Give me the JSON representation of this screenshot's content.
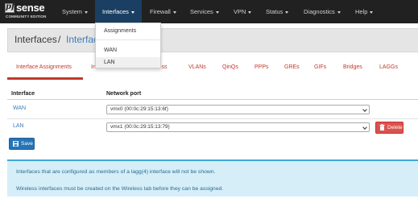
{
  "brand": {
    "pf": "pf",
    "sense": "sense",
    "edition": "COMMUNITY EDITION"
  },
  "navbar": {
    "items": [
      {
        "label": "System"
      },
      {
        "label": "Interfaces"
      },
      {
        "label": "Firewall"
      },
      {
        "label": "Services"
      },
      {
        "label": "VPN"
      },
      {
        "label": "Status"
      },
      {
        "label": "Diagnostics"
      },
      {
        "label": "Help"
      }
    ],
    "active": "Interfaces"
  },
  "dropdown": {
    "items": [
      {
        "label": "Assignments"
      },
      {
        "label": "WAN"
      },
      {
        "label": "LAN"
      }
    ],
    "highlighted": "LAN"
  },
  "breadcrumb": {
    "root": "Interfaces",
    "separator": "/",
    "current": "Interfac"
  },
  "tabs": [
    {
      "label": "Interface Assignments"
    },
    {
      "label": "In"
    },
    {
      "label": "less"
    },
    {
      "label": "VLANs"
    },
    {
      "label": "QinQs"
    },
    {
      "label": "PPPs"
    },
    {
      "label": "GREs"
    },
    {
      "label": "GIFs"
    },
    {
      "label": "Bridges"
    },
    {
      "label": "LAGGs"
    }
  ],
  "table": {
    "headers": {
      "interface": "Interface",
      "port": "Network port"
    },
    "rows": [
      {
        "interface": "WAN",
        "port": "vmx0 (00:0c:29:15:13:6f)"
      },
      {
        "interface": "LAN",
        "port": "vmx1 (00:0c:29:15:13:79)"
      }
    ]
  },
  "buttons": {
    "delete": "Delete",
    "save": "Save"
  },
  "info": {
    "line1": "Interfaces that are configured as members of a lagg(4) interface will not be shown.",
    "line2": "Wireless interfaces must be created on the Wireless tab before they can be assigned."
  },
  "colors": {
    "navbar": "#212121",
    "nav_active": "#1a3f63",
    "accent_red": "#c0392b",
    "link_blue": "#3d7cb9",
    "delete_red": "#d9534f",
    "save_blue": "#2574b7",
    "info_bg": "#d6eef8"
  },
  "icons": {
    "delete": "trash-icon",
    "save": "save-icon"
  }
}
